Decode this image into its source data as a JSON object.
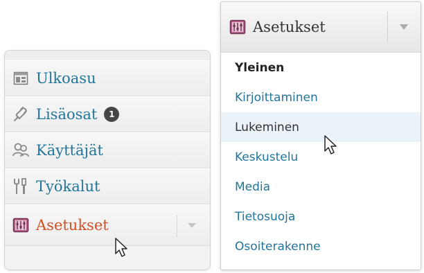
{
  "menu": {
    "items": [
      {
        "label": "Ulkoasu",
        "icon": "appearance-icon"
      },
      {
        "label": "Lisäosat",
        "icon": "plugins-icon",
        "badge": "1"
      },
      {
        "label": "Käyttäjät",
        "icon": "users-icon"
      },
      {
        "label": "Työkalut",
        "icon": "tools-icon"
      },
      {
        "label": "Asetukset",
        "icon": "settings-icon",
        "active": true
      }
    ]
  },
  "dropdown": {
    "title": "Asetukset",
    "items": [
      {
        "label": "Yleinen",
        "current": true
      },
      {
        "label": "Kirjoittaminen"
      },
      {
        "label": "Lukeminen",
        "hover": true
      },
      {
        "label": "Keskustelu"
      },
      {
        "label": "Media"
      },
      {
        "label": "Tietosuoja"
      },
      {
        "label": "Osoiterakenne"
      }
    ]
  },
  "colors": {
    "link": "#21759b",
    "active": "#d54e21",
    "hover_bg": "#eaf2fa",
    "badge_bg": "#464646"
  }
}
